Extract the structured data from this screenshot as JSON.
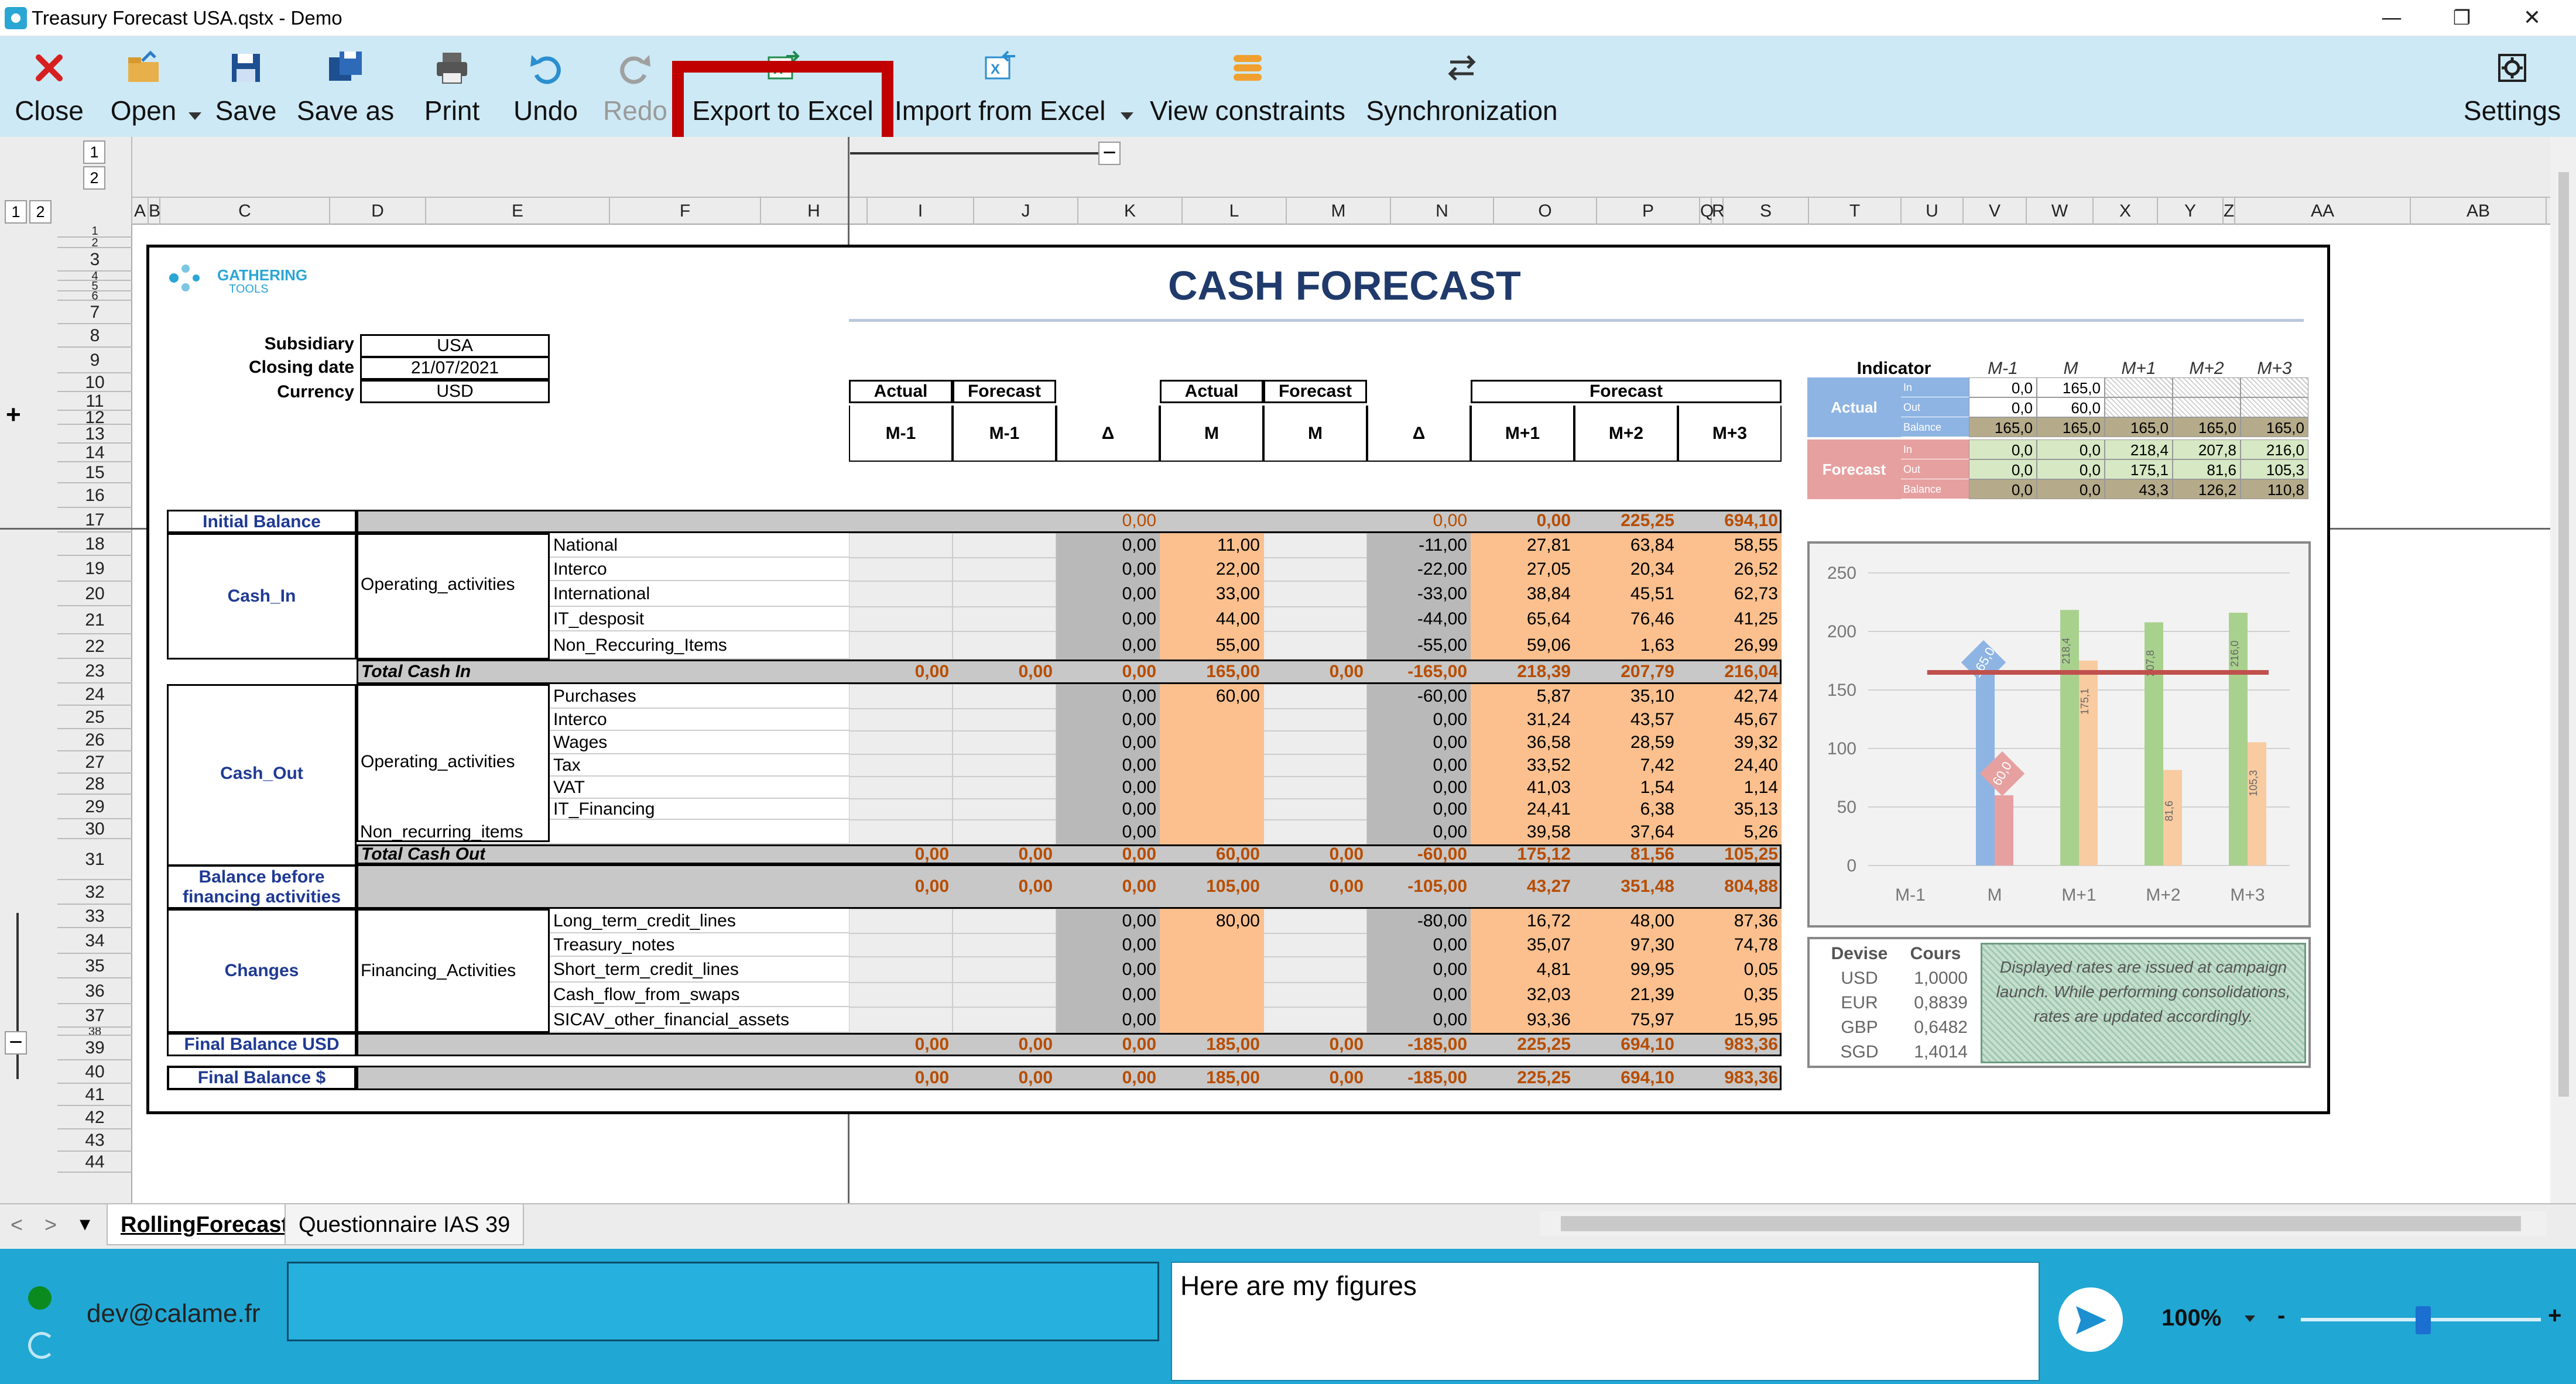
{
  "window": {
    "title": "Treasury Forecast USA.qstx - Demo",
    "minimize": "—",
    "maximize": "❐",
    "close": "✕"
  },
  "toolbar": [
    {
      "label": "Close",
      "icon": "close-icon"
    },
    {
      "label": "Open",
      "icon": "open-folder-icon"
    },
    {
      "label": "Save",
      "icon": "save-disk-icon"
    },
    {
      "label": "Save as",
      "icon": "save-as-icon"
    },
    {
      "label": "Print",
      "icon": "printer-icon"
    },
    {
      "label": "Undo",
      "icon": "undo-icon"
    },
    {
      "label": "Redo",
      "icon": "redo-icon",
      "disabled": true
    },
    {
      "label": "Export to Excel",
      "icon": "excel-export-icon",
      "highlighted": true
    },
    {
      "label": "Import from Excel",
      "icon": "excel-import-icon"
    },
    {
      "label": "View constraints",
      "icon": "constraints-icon"
    },
    {
      "label": "Synchronization",
      "icon": "sync-arrows-icon"
    },
    {
      "label": "Settings",
      "icon": "gear-icon"
    }
  ],
  "outline": {
    "levels": [
      "1",
      "2"
    ],
    "expand": "+",
    "collapse": "−"
  },
  "columns": [
    "A",
    "B",
    "C",
    "D",
    "E",
    "F",
    "H",
    "I",
    "J",
    "K",
    "L",
    "M",
    "N",
    "O",
    "P",
    "Q",
    "R",
    "S",
    "T",
    "U",
    "V",
    "W",
    "X",
    "Y",
    "Z",
    "AA",
    "AB"
  ],
  "rows": [
    "1",
    "2",
    "3",
    "4",
    "5",
    "6",
    "7",
    "8",
    "9",
    "10",
    "11",
    "12",
    "13",
    "14",
    "15",
    "16",
    "17",
    "18",
    "19",
    "20",
    "21",
    "22",
    "23",
    "24",
    "25",
    "26",
    "27",
    "28",
    "29",
    "30",
    "31",
    "32",
    "33",
    "34",
    "35",
    "36",
    "37",
    "38",
    "39",
    "40",
    "41",
    "42",
    "43",
    "44"
  ],
  "report": {
    "logo_line1": "GATHERING",
    "logo_line2": "TOOLS",
    "title": "CASH FORECAST",
    "subsidiary_label": "Subsidiary",
    "subsidiary": "USA",
    "closing_date_label": "Closing date",
    "closing_date": "21/07/2021",
    "currency_label": "Currency",
    "currency": "USD",
    "head_actual": "Actual",
    "head_forecast": "Forecast",
    "head_delta": "Δ",
    "periods": {
      "m1": "M-1",
      "m": "M",
      "p1": "M+1",
      "p2": "M+2",
      "p3": "M+3"
    },
    "sections": {
      "initial": "Initial Balance",
      "cash_in": "Cash_In",
      "cash_out": "Cash_Out",
      "balance_before": "Balance before financing activities",
      "changes": "Changes",
      "final_usd": "Final Balance USD",
      "final_dollar": "Final Balance $"
    },
    "groups": {
      "operating": "Operating_activities",
      "operating_out": "Operating_activities",
      "financing": "Financing_Activities",
      "non_recurring": "Non_recurring_items"
    },
    "totals": {
      "cash_in": "Total Cash In",
      "cash_out": "Total Cash Out"
    },
    "initial_row": {
      "delta1": "0,00",
      "delta2": "0,00",
      "p1": "0,00",
      "p2": "225,25",
      "p3": "694,10"
    },
    "cash_in_lines": [
      {
        "label": "National",
        "d1": "0,00",
        "m": "11,00",
        "d2": "-11,00",
        "p1": "27,81",
        "p2": "63,84",
        "p3": "58,55"
      },
      {
        "label": "Interco",
        "d1": "0,00",
        "m": "22,00",
        "d2": "-22,00",
        "p1": "27,05",
        "p2": "20,34",
        "p3": "26,52"
      },
      {
        "label": "International",
        "d1": "0,00",
        "m": "33,00",
        "d2": "-33,00",
        "p1": "38,84",
        "p2": "45,51",
        "p3": "62,73"
      },
      {
        "label": "IT_desposit",
        "d1": "0,00",
        "m": "44,00",
        "d2": "-44,00",
        "p1": "65,64",
        "p2": "76,46",
        "p3": "41,25"
      },
      {
        "label": "Non_Reccuring_Items",
        "d1": "0,00",
        "m": "55,00",
        "d2": "-55,00",
        "p1": "59,06",
        "p2": "1,63",
        "p3": "26,99"
      }
    ],
    "total_in": {
      "a1": "0,00",
      "f1": "0,00",
      "d1": "0,00",
      "m": "165,00",
      "fm": "0,00",
      "d2": "-165,00",
      "p1": "218,39",
      "p2": "207,79",
      "p3": "216,04"
    },
    "cash_out_lines": [
      {
        "label": "Purchases",
        "d1": "0,00",
        "m": "60,00",
        "d2": "-60,00",
        "p1": "5,87",
        "p2": "35,10",
        "p3": "42,74"
      },
      {
        "label": "Interco",
        "d1": "0,00",
        "m": "",
        "d2": "0,00",
        "p1": "31,24",
        "p2": "43,57",
        "p3": "45,67"
      },
      {
        "label": "Wages",
        "d1": "0,00",
        "m": "",
        "d2": "0,00",
        "p1": "36,58",
        "p2": "28,59",
        "p3": "39,32"
      },
      {
        "label": "Tax",
        "d1": "0,00",
        "m": "",
        "d2": "0,00",
        "p1": "33,52",
        "p2": "7,42",
        "p3": "24,40"
      },
      {
        "label": "VAT",
        "d1": "0,00",
        "m": "",
        "d2": "0,00",
        "p1": "41,03",
        "p2": "1,54",
        "p3": "1,14"
      },
      {
        "label": "IT_Financing",
        "d1": "0,00",
        "m": "",
        "d2": "0,00",
        "p1": "24,41",
        "p2": "6,38",
        "p3": "35,13"
      }
    ],
    "non_recurring_line": {
      "d1": "0,00",
      "d2": "0,00",
      "p1": "39,58",
      "p2": "37,64",
      "p3": "5,26"
    },
    "total_out": {
      "a1": "0,00",
      "f1": "0,00",
      "d1": "0,00",
      "m": "60,00",
      "fm": "0,00",
      "d2": "-60,00",
      "p1": "175,12",
      "p2": "81,56",
      "p3": "105,25"
    },
    "balance_before": {
      "a1": "0,00",
      "f1": "0,00",
      "d1": "0,00",
      "m": "105,00",
      "fm": "0,00",
      "d2": "-105,00",
      "p1": "43,27",
      "p2": "351,48",
      "p3": "804,88"
    },
    "changes_lines": [
      {
        "label": "Long_term_credit_lines",
        "d1": "0,00",
        "m": "80,00",
        "d2": "-80,00",
        "p1": "16,72",
        "p2": "48,00",
        "p3": "87,36"
      },
      {
        "label": "Treasury_notes",
        "d1": "0,00",
        "m": "",
        "d2": "0,00",
        "p1": "35,07",
        "p2": "97,30",
        "p3": "74,78"
      },
      {
        "label": "Short_term_credit_lines",
        "d1": "0,00",
        "m": "",
        "d2": "0,00",
        "p1": "4,81",
        "p2": "99,95",
        "p3": "0,05"
      },
      {
        "label": "Cash_flow_from_swaps",
        "d1": "0,00",
        "m": "",
        "d2": "0,00",
        "p1": "32,03",
        "p2": "21,39",
        "p3": "0,35"
      },
      {
        "label": "SICAV_other_financial_assets",
        "d1": "0,00",
        "m": "",
        "d2": "0,00",
        "p1": "93,36",
        "p2": "75,97",
        "p3": "15,95"
      }
    ],
    "final_usd": {
      "a1": "0,00",
      "f1": "0,00",
      "d1": "0,00",
      "m": "185,00",
      "fm": "0,00",
      "d2": "-185,00",
      "p1": "225,25",
      "p2": "694,10",
      "p3": "983,36"
    },
    "final_dollar": {
      "a1": "0,00",
      "f1": "0,00",
      "d1": "0,00",
      "m": "185,00",
      "fm": "0,00",
      "d2": "-185,00",
      "p1": "225,25",
      "p2": "694,10",
      "p3": "983,36"
    }
  },
  "indicator": {
    "title": "Indicator",
    "cols": [
      "M-1",
      "M",
      "M+1",
      "M+2",
      "M+3"
    ],
    "actual_label": "Actual",
    "forecast_label": "Forecast",
    "sub": [
      "In",
      "Out",
      "Balance"
    ],
    "actual": [
      [
        "0,0",
        "165,0",
        "",
        "",
        ""
      ],
      [
        "0,0",
        "60,0",
        "",
        "",
        ""
      ],
      [
        "165,0",
        "165,0",
        "165,0",
        "165,0",
        "165,0"
      ]
    ],
    "forecast": [
      [
        "0,0",
        "0,0",
        "218,4",
        "207,8",
        "216,0"
      ],
      [
        "0,0",
        "0,0",
        "175,1",
        "81,6",
        "105,3"
      ],
      [
        "0,0",
        "0,0",
        "43,3",
        "126,2",
        "110,8"
      ]
    ]
  },
  "chart_data": {
    "type": "bar",
    "categories": [
      "M-1",
      "M",
      "M+1",
      "M+2",
      "M+3"
    ],
    "ylim": [
      0,
      250
    ],
    "yticks": [
      "0",
      "50",
      "100",
      "150",
      "200",
      "250"
    ],
    "series": [
      {
        "key": "in",
        "values": [
          0,
          165,
          218.4,
          207.8,
          216.0
        ],
        "color": "#a9d18e",
        "actual_color": "#8eb4e3"
      },
      {
        "key": "out",
        "values": [
          0,
          60,
          175.1,
          81.6,
          105.3
        ],
        "color": "#f8cba0",
        "actual_color": "#e6a0a0"
      }
    ],
    "reference_line": 165,
    "reference_color": "#c0504d",
    "data_labels": {
      "m_in": "165,0",
      "m_out": "60,0",
      "p1_in": "218,4",
      "p1_out": "175,1",
      "p2_in": "207,8",
      "p2_out": "81,6",
      "p3_in": "216,0",
      "p3_out": "105,3"
    }
  },
  "rates": {
    "head_currency": "Devise",
    "head_rate": "Cours",
    "rows": [
      [
        "USD",
        "1,0000"
      ],
      [
        "EUR",
        "0,8839"
      ],
      [
        "GBP",
        "0,6482"
      ],
      [
        "SGD",
        "1,4014"
      ]
    ],
    "note": "Displayed rates are issued at campaign launch. While performing consolidations, rates are updated accordingly."
  },
  "tabs": {
    "nav_prev": "<",
    "nav_next": ">",
    "nav_menu": "▾",
    "active": "RollingForecast",
    "other": "Questionnaire IAS 39"
  },
  "status": {
    "user": "dev@calame.fr",
    "comment_value": "Here are my figures",
    "zoom": "100%",
    "zoom_minus": "-",
    "zoom_plus": "+"
  }
}
